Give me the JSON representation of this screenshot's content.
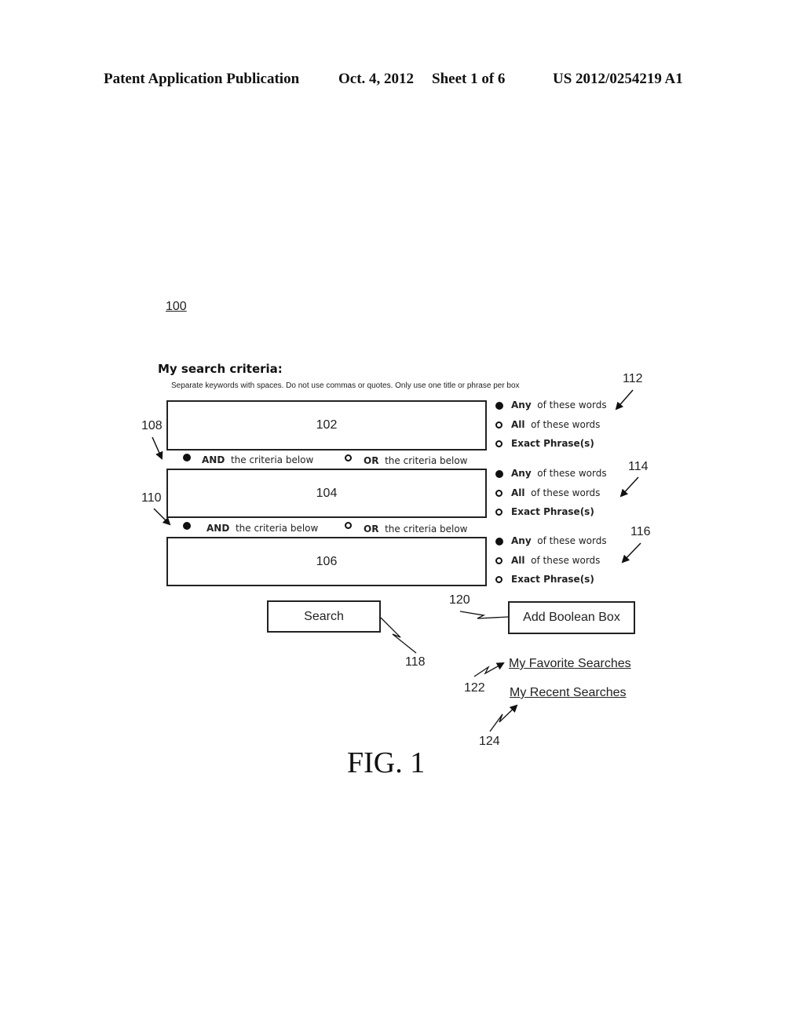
{
  "header": {
    "publication": "Patent Application Publication",
    "date": "Oct. 4, 2012",
    "sheet": "Sheet 1 of 6",
    "number": "US 2012/0254219 A1"
  },
  "figure": {
    "ref_main": "100",
    "caption": "FIG. 1"
  },
  "search_form": {
    "title": "My search criteria:",
    "instructions": "Separate keywords with spaces.  Do not use commas or quotes. Only use one title or phrase per box",
    "boxes": [
      {
        "label": "102",
        "options_ref": "112",
        "options": [
          {
            "bold": "Any",
            "rest": "of these words",
            "selected": true
          },
          {
            "bold": "All",
            "rest": "of these words",
            "selected": false
          },
          {
            "bold": "Exact Phrase(s)",
            "rest": "",
            "selected": false
          }
        ]
      },
      {
        "label": "104",
        "options_ref": "114",
        "options": [
          {
            "bold": "Any",
            "rest": "of these words",
            "selected": true
          },
          {
            "bold": "All",
            "rest": "of these words",
            "selected": false
          },
          {
            "bold": "Exact Phrase(s)",
            "rest": "",
            "selected": false
          }
        ]
      },
      {
        "label": "106",
        "options_ref": "116",
        "options": [
          {
            "bold": "Any",
            "rest": "of these words",
            "selected": true
          },
          {
            "bold": "All",
            "rest": "of these words",
            "selected": false
          },
          {
            "bold": "Exact Phrase(s)",
            "rest": "",
            "selected": false
          }
        ]
      }
    ],
    "connectors": [
      {
        "ref": "108",
        "and_bold": "AND",
        "and_rest": "the criteria below",
        "and_selected": true,
        "or_bold": "OR",
        "or_rest": "the criteria below",
        "or_selected": false
      },
      {
        "ref": "110",
        "and_bold": "AND",
        "and_rest": "the criteria below",
        "and_selected": true,
        "or_bold": "OR",
        "or_rest": "the criteria below",
        "or_selected": false
      }
    ],
    "search_button": {
      "label": "Search",
      "ref": "118"
    },
    "add_boolean_button": {
      "label": "Add Boolean Box",
      "ref": "120"
    },
    "links": [
      {
        "label": "My Favorite Searches",
        "ref": "122"
      },
      {
        "label": "My Recent Searches",
        "ref": "124"
      }
    ]
  }
}
